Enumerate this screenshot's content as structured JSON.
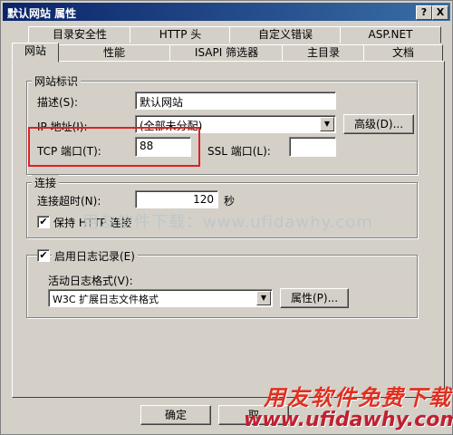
{
  "window": {
    "title": "默认网站 属性",
    "help_btn": "?",
    "close_btn": "X"
  },
  "tabs_back": [
    "目录安全性",
    "HTTP 头",
    "自定义错误",
    "ASP.NET"
  ],
  "tabs_front": [
    "网站",
    "性能",
    "ISAPI 筛选器",
    "主目录",
    "文档"
  ],
  "site_id": {
    "legend": "网站标识",
    "desc_label": "描述(S):",
    "desc_value": "默认网站",
    "ip_label": "IP 地址(I):",
    "ip_value": "(全部未分配)",
    "advanced_btn": "高级(D)...",
    "tcp_label": "TCP 端口(T):",
    "tcp_value": "88",
    "ssl_label": "SSL 端口(L):",
    "ssl_value": ""
  },
  "connection": {
    "legend": "连接",
    "timeout_label": "连接超时(N):",
    "timeout_value": "120",
    "timeout_unit": "秒",
    "keepalive_checked": true,
    "keepalive_label": "保持 HTTP 连接"
  },
  "logging": {
    "enabled": true,
    "legend": "启用日志记录(E)",
    "format_label": "活动日志格式(V):",
    "format_value": "W3C 扩展日志文件格式",
    "props_btn": "属性(P)..."
  },
  "footer": {
    "ok_btn": "确定",
    "cancel_btn": "取"
  },
  "watermarks": {
    "center": "用友软件下载：www.ufidawhy.com",
    "brand": "用友软件免费下载",
    "url": "www.ufidawhy.com"
  }
}
